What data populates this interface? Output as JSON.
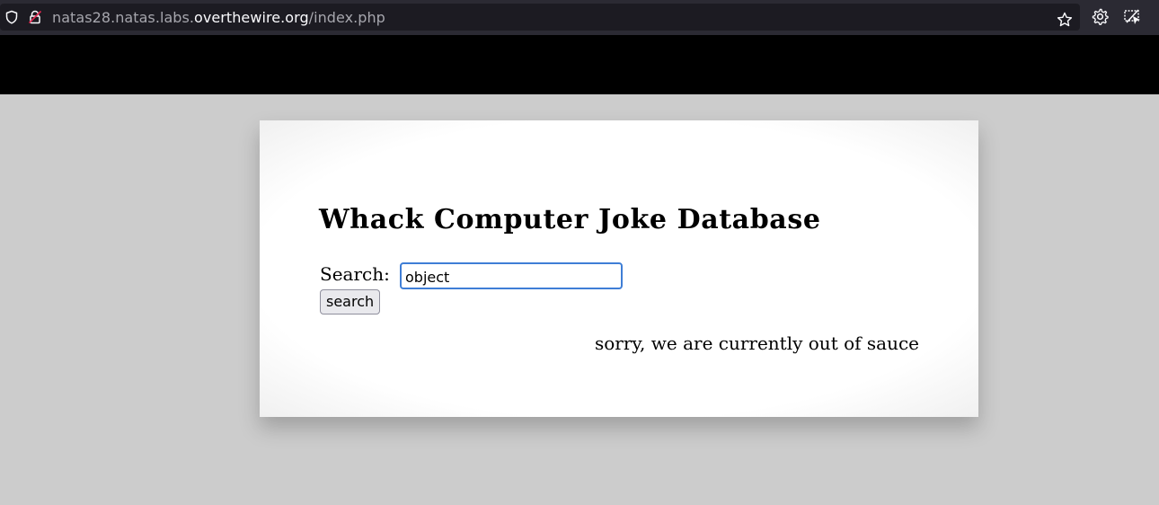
{
  "browser": {
    "url_prefix": "natas28.natas.labs.",
    "url_domain": "overthewire.org",
    "url_path": "/index.php",
    "icons": {
      "shield": "shield-icon",
      "lock": "lock-warning-icon",
      "bookmark": "star-icon",
      "settings": "gear-icon",
      "extension": "extension-icon"
    }
  },
  "page": {
    "title": "Whack Computer Joke Database",
    "search_label": "Search:",
    "search_value": "object",
    "search_button": "search",
    "result_message": "sorry, we are currently out of sauce"
  },
  "colors": {
    "toolbar": "#2b2a33",
    "urlbar": "#1c1b22",
    "banner": "#000000",
    "background": "#cccccc",
    "focus": "#3f7ed6"
  }
}
